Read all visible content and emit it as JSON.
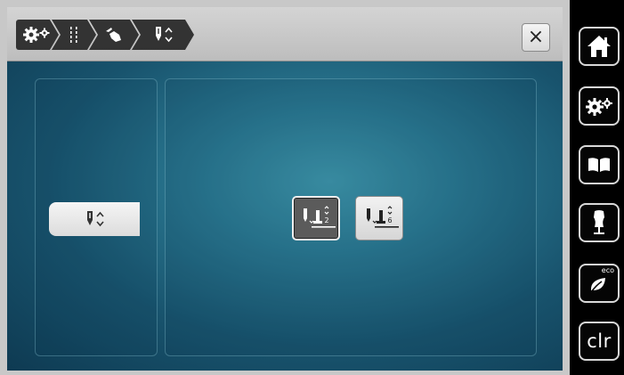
{
  "header": {
    "close_label": "×"
  },
  "breadcrumb": [
    {
      "icon": "settings-gears-icon"
    },
    {
      "icon": "stitch-settings-icon"
    },
    {
      "icon": "hand-feed-icon"
    },
    {
      "icon": "needle-position-icon"
    }
  ],
  "left_panel": {
    "tab_icon": "needle-up-down-icon"
  },
  "options": [
    {
      "icon": "presser-foot-height-icon",
      "number": "2",
      "selected": true
    },
    {
      "icon": "presser-foot-height-icon",
      "number": "6",
      "selected": false
    }
  ],
  "sidebar": {
    "buttons": [
      {
        "icon": "home-icon"
      },
      {
        "icon": "settings-icon"
      },
      {
        "icon": "guide-book-icon"
      },
      {
        "icon": "dress-form-icon"
      },
      {
        "icon": "eco-leaf-icon",
        "label": "eco"
      },
      {
        "label": "clr"
      }
    ]
  },
  "colors": {
    "screen_bg_center": "#3f97ac",
    "screen_bg_edge": "#0e3a52",
    "crumb_bg": "#333333",
    "sidebar_bg": "#000000"
  }
}
